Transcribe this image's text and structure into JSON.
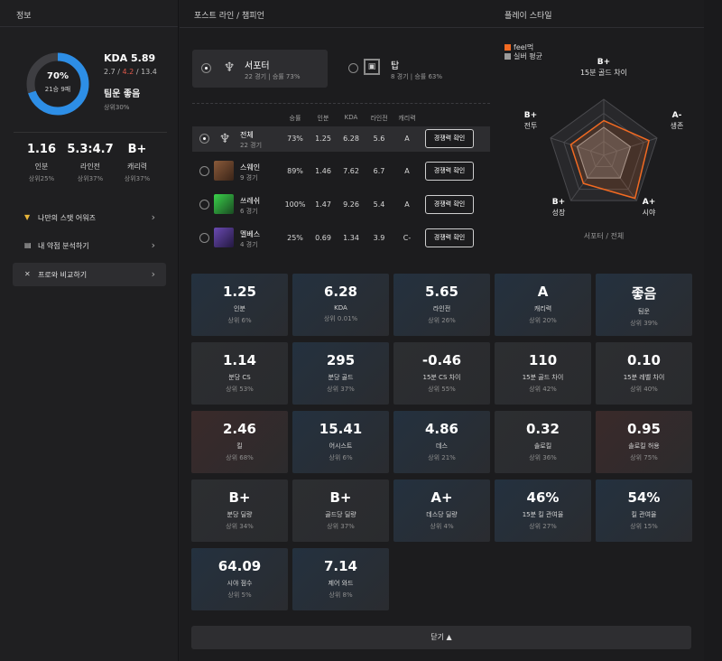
{
  "colors": {
    "win_blue": "#2d8ee6",
    "loss_gray": "#3e3e42",
    "deaths_red": "#e0584a",
    "me_orange": "#f26a22",
    "avg_gray": "#9a9a9a"
  },
  "left": {
    "header": "정보",
    "winrate": {
      "pct": "70%",
      "record": "21승 9패",
      "value": 0.7
    },
    "kda_title": "KDA 5.89",
    "kda": {
      "k": "2.7",
      "d": "4.2",
      "a": "13.4",
      "sep": "/"
    },
    "team": "팀운 좋음",
    "team_rank": "상위30%",
    "stats": [
      {
        "value": "1.16",
        "label": "인분",
        "rank": "상위25%"
      },
      {
        "value": "5.3:4.7",
        "label": "라인전",
        "rank": "상위37%"
      },
      {
        "value": "B+",
        "label": "캐리력",
        "rank": "상위37%"
      }
    ],
    "menu": [
      {
        "label": "나만의 스탯 어워즈",
        "icon": "trophy-icon"
      },
      {
        "label": "내 약점 분석하기",
        "icon": "chart-icon"
      },
      {
        "label": "프로와 비교하기",
        "icon": "versus-icon"
      }
    ]
  },
  "main": {
    "col_headers": {
      "position": "포스트 라인 / 챔피언",
      "playstyle": "플레이 스타일"
    },
    "positions": [
      {
        "name": "서포터",
        "sub": "22 경기 | 승률 73%",
        "selected": true
      },
      {
        "name": "탑",
        "sub": "8 경기 | 승률 63%",
        "selected": false
      }
    ],
    "table_headers": [
      "승률",
      "인분",
      "KDA",
      "라인전",
      "캐리력"
    ],
    "champions": [
      {
        "name": "전체",
        "games": "22 경기",
        "winrate": "73%",
        "inbun": "1.25",
        "kda": "6.28",
        "lane": "5.6",
        "carry": "A",
        "button": "경쟁력 확인",
        "selected": true
      },
      {
        "name": "스웨인",
        "games": "9 경기",
        "winrate": "89%",
        "inbun": "1.46",
        "kda": "7.62",
        "lane": "6.7",
        "carry": "A",
        "button": "경쟁력 확인",
        "selected": false
      },
      {
        "name": "쓰레쉬",
        "games": "6 경기",
        "winrate": "100%",
        "inbun": "1.47",
        "kda": "9.26",
        "lane": "5.4",
        "carry": "A",
        "button": "경쟁력 확인",
        "selected": false
      },
      {
        "name": "멜베스",
        "games": "4 경기",
        "winrate": "25%",
        "inbun": "0.69",
        "kda": "1.34",
        "lane": "3.9",
        "carry": "C-",
        "button": "경쟁력 확인",
        "selected": false
      }
    ],
    "radar": {
      "legend": [
        "feel먹",
        "실버 평균"
      ],
      "axes": [
        {
          "grade": "B+",
          "label": "15분 골드 차이"
        },
        {
          "grade": "A-",
          "label": "생존"
        },
        {
          "grade": "A+",
          "label": "시야"
        },
        {
          "grade": "B+",
          "label": "성장"
        },
        {
          "grade": "B+",
          "label": "전투"
        }
      ],
      "me": [
        0.62,
        0.85,
        0.95,
        0.62,
        0.62
      ],
      "avg": [
        0.5,
        0.5,
        0.5,
        0.5,
        0.5
      ],
      "footer": "서포터 / 전체"
    },
    "tiles": [
      {
        "value": "1.25",
        "label": "인분",
        "rank": "상위 6%",
        "tone": "blue"
      },
      {
        "value": "6.28",
        "label": "KDA",
        "rank": "상위 0.01%",
        "tone": "blue"
      },
      {
        "value": "5.65",
        "label": "라인전",
        "rank": "상위 26%",
        "tone": "blue"
      },
      {
        "value": "A",
        "label": "캐리력",
        "rank": "상위 20%",
        "tone": "blue"
      },
      {
        "value": "좋음",
        "label": "팀운",
        "rank": "상위 39%",
        "tone": "blue"
      },
      {
        "value": "1.14",
        "label": "분당 CS",
        "rank": "상위 53%",
        "tone": "gray"
      },
      {
        "value": "295",
        "label": "분당 골드",
        "rank": "상위 37%",
        "tone": "blue"
      },
      {
        "value": "-0.46",
        "label": "15분 CS 차이",
        "rank": "상위 55%",
        "tone": "gray"
      },
      {
        "value": "110",
        "label": "15분 골드 차이",
        "rank": "상위 42%",
        "tone": "gray"
      },
      {
        "value": "0.10",
        "label": "15분 레벨 차이",
        "rank": "상위 40%",
        "tone": "gray"
      },
      {
        "value": "2.46",
        "label": "킬",
        "rank": "상위 68%",
        "tone": "red"
      },
      {
        "value": "15.41",
        "label": "어시스트",
        "rank": "상위 6%",
        "tone": "blue"
      },
      {
        "value": "4.86",
        "label": "데스",
        "rank": "상위 21%",
        "tone": "blue"
      },
      {
        "value": "0.32",
        "label": "솔로킬",
        "rank": "상위 36%",
        "tone": "gray"
      },
      {
        "value": "0.95",
        "label": "솔로킬 허용",
        "rank": "상위 75%",
        "tone": "red"
      },
      {
        "value": "B+",
        "label": "분당 딜량",
        "rank": "상위 34%",
        "tone": "gray"
      },
      {
        "value": "B+",
        "label": "골드당 딜량",
        "rank": "상위 37%",
        "tone": "gray"
      },
      {
        "value": "A+",
        "label": "데스당 딜량",
        "rank": "상위 4%",
        "tone": "blue"
      },
      {
        "value": "46%",
        "label": "15분 킬 관여율",
        "rank": "상위 27%",
        "tone": "blue"
      },
      {
        "value": "54%",
        "label": "킬 관여율",
        "rank": "상위 15%",
        "tone": "blue"
      },
      {
        "value": "64.09",
        "label": "시야 점수",
        "rank": "상위 5%",
        "tone": "blue"
      },
      {
        "value": "7.14",
        "label": "제어 와드",
        "rank": "상위 8%",
        "tone": "blue"
      }
    ],
    "close_label": "닫기 ▲"
  }
}
